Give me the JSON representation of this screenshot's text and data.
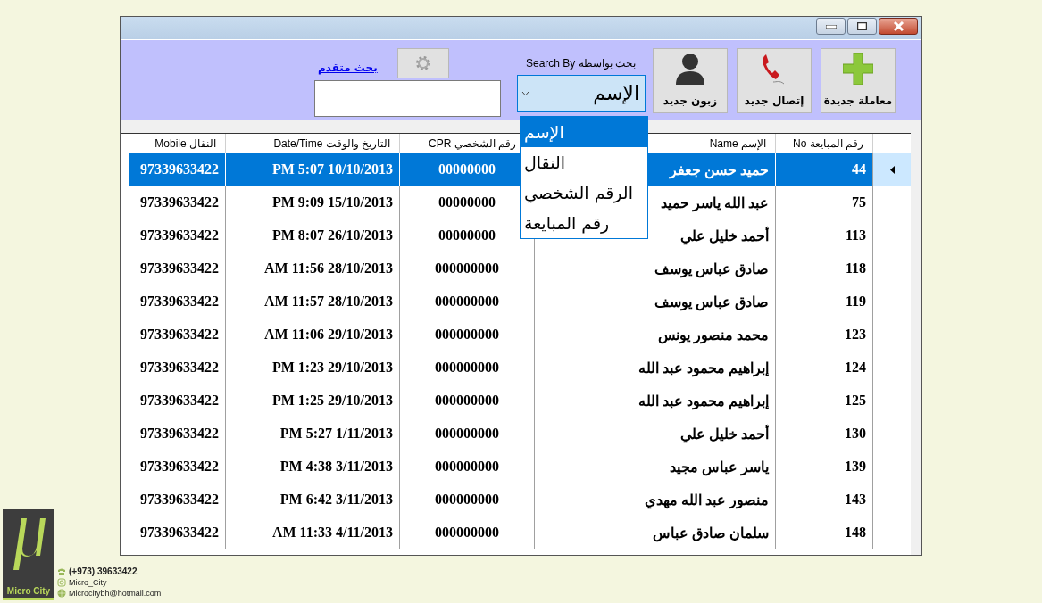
{
  "toolbar": {
    "buttons": [
      {
        "kind": "plus",
        "label": "معاملة جديدة"
      },
      {
        "kind": "phone",
        "label": "إتصال جديد"
      },
      {
        "kind": "person",
        "label": "زبون جديد"
      }
    ],
    "search_by": {
      "label": "بحث بواسطة Search By",
      "value": "الإسم",
      "expanded": true,
      "options": [
        {
          "label": "الإسم",
          "selected": true
        },
        {
          "label": "النقال",
          "selected": false
        },
        {
          "label": "الرقم الشخصي",
          "selected": false
        },
        {
          "label": "رقم المبايعة",
          "selected": false
        }
      ]
    },
    "advanced_search_link": "بحث متقدم"
  },
  "table": {
    "columns": [
      "رقم المبايعة No",
      "الإسم Name",
      "رقم الشخصي CPR",
      "التاريخ والوقت Date/Time",
      "النقال Mobile"
    ],
    "rows": [
      {
        "selected": true,
        "cells": [
          "44",
          "حميد حسن جعفر",
          "00000000",
          "PM 5:07 10/10/2013",
          "97339633422"
        ]
      },
      {
        "selected": false,
        "cells": [
          "75",
          "عبد الله ياسر حميد",
          "00000000",
          "PM 9:09 15/10/2013",
          "97339633422"
        ]
      },
      {
        "selected": false,
        "cells": [
          "113",
          "أحمد خليل علي",
          "00000000",
          "PM 8:07 26/10/2013",
          "97339633422"
        ]
      },
      {
        "selected": false,
        "cells": [
          "118",
          "صادق عباس يوسف",
          "000000000",
          "AM 11:56 28/10/2013",
          "97339633422"
        ]
      },
      {
        "selected": false,
        "cells": [
          "119",
          "صادق عباس يوسف",
          "000000000",
          "AM 11:57 28/10/2013",
          "97339633422"
        ]
      },
      {
        "selected": false,
        "cells": [
          "123",
          "محمد منصور يونس",
          "000000000",
          "AM 11:06 29/10/2013",
          "97339633422"
        ]
      },
      {
        "selected": false,
        "cells": [
          "124",
          "إبراهيم محمود عبد الله",
          "000000000",
          "PM 1:23 29/10/2013",
          "97339633422"
        ]
      },
      {
        "selected": false,
        "cells": [
          "125",
          "إبراهيم محمود عبد الله",
          "000000000",
          "PM 1:25 29/10/2013",
          "97339633422"
        ]
      },
      {
        "selected": false,
        "cells": [
          "130",
          "أحمد خليل علي",
          "000000000",
          "PM 5:27 1/11/2013",
          "97339633422"
        ]
      },
      {
        "selected": false,
        "cells": [
          "139",
          "ياسر عباس مجيد",
          "000000000",
          "PM 4:38 3/11/2013",
          "97339633422"
        ]
      },
      {
        "selected": false,
        "cells": [
          "143",
          "منصور عبد الله مهدي",
          "000000000",
          "PM 6:42 3/11/2013",
          "97339633422"
        ]
      },
      {
        "selected": false,
        "cells": [
          "148",
          "سلمان صادق عباس",
          "000000000",
          "AM 11:33 4/11/2013",
          "97339633422"
        ]
      }
    ]
  },
  "brand": {
    "name": "Micro City",
    "contacts": [
      {
        "kind": "phone",
        "text": "(+973) 39633422"
      },
      {
        "kind": "instagram",
        "text": "Micro_City"
      },
      {
        "kind": "web",
        "text": "Microcitybh@hotmail.com"
      }
    ]
  }
}
